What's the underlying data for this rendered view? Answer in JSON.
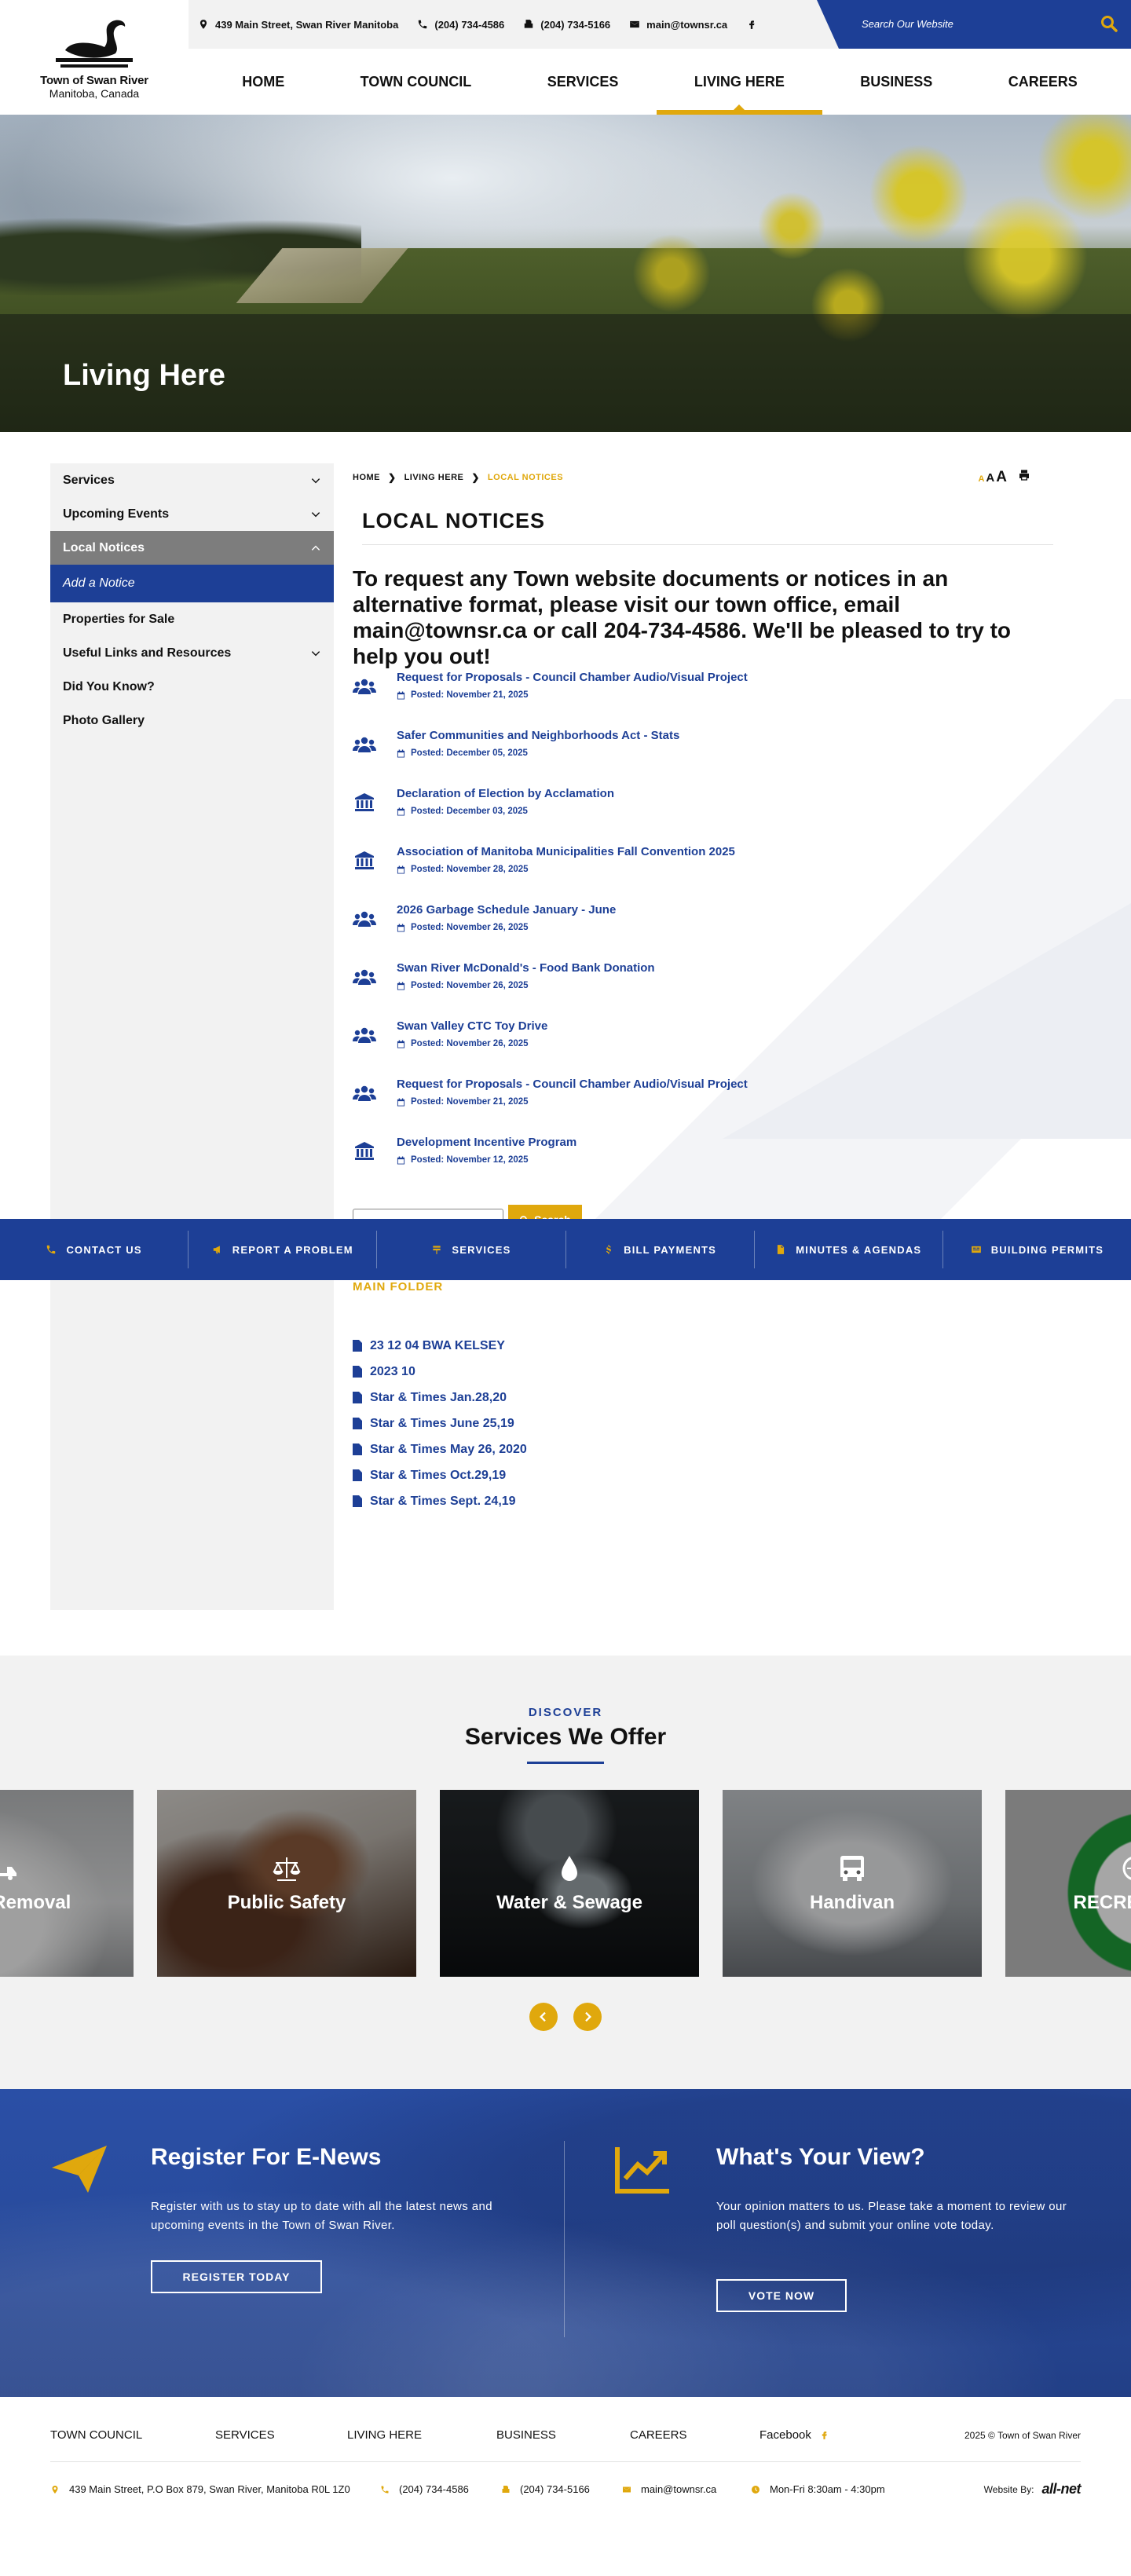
{
  "brand": {
    "name": "Town of Swan River",
    "sub": "Manitoba, Canada"
  },
  "topbar": {
    "address": "439 Main Street, Swan River Manitoba",
    "phone": "(204) 734-4586",
    "fax": "(204) 734-5166",
    "email": "main@townsr.ca",
    "search_placeholder": "Search Our Website"
  },
  "nav": [
    {
      "label": "HOME"
    },
    {
      "label": "TOWN COUNCIL"
    },
    {
      "label": "SERVICES"
    },
    {
      "label": "LIVING HERE",
      "active": true
    },
    {
      "label": "BUSINESS"
    },
    {
      "label": "CAREERS"
    }
  ],
  "hero": {
    "title": "Living Here"
  },
  "sidebar": {
    "items": [
      {
        "label": "Services",
        "chevron": "down"
      },
      {
        "label": "Upcoming Events",
        "chevron": "down"
      },
      {
        "label": "Local Notices",
        "chevron": "up",
        "state": "active"
      },
      {
        "label": "Add a Notice",
        "state": "sub"
      },
      {
        "label": "Properties for Sale"
      },
      {
        "label": "Useful Links and Resources",
        "chevron": "down"
      },
      {
        "label": "Did You Know?"
      },
      {
        "label": "Photo Gallery"
      }
    ]
  },
  "breadcrumb": {
    "home": "HOME",
    "section": "LIVING HERE",
    "current": "LOCAL NOTICES"
  },
  "text_tools": {
    "small": "A",
    "medium": "A",
    "large": "A"
  },
  "page": {
    "title": "LOCAL NOTICES",
    "intro": "To request any Town website documents or notices in an alternative format, please visit our town office, email main@townsr.ca or call 204-734-4586. We'll be pleased to try to help you out!"
  },
  "notices": [
    {
      "title": "Request for Proposals - Council Chamber Audio/Visual Project",
      "date": "Posted: November 21, 2025",
      "icon": "people-icon"
    },
    {
      "title": "Safer Communities and Neighborhoods Act - Stats",
      "date": "Posted: December 05, 2025",
      "icon": "people-icon"
    },
    {
      "title": "Declaration of Election by Acclamation",
      "date": "Posted: December 03, 2025",
      "icon": "building-icon"
    },
    {
      "title": "Association of Manitoba Municipalities Fall Convention 2025",
      "date": "Posted: November 28, 2025",
      "icon": "building-icon"
    },
    {
      "title": "2026 Garbage Schedule January - June",
      "date": "Posted: November 26, 2025",
      "icon": "people-icon"
    },
    {
      "title": "Swan River McDonald's - Food Bank Donation",
      "date": "Posted: November 26, 2025",
      "icon": "people-icon"
    },
    {
      "title": "Swan Valley CTC Toy Drive",
      "date": "Posted: November 26, 2025",
      "icon": "people-icon"
    },
    {
      "title": "Request for Proposals - Council Chamber Audio/Visual Project",
      "date": "Posted: November 21, 2025",
      "icon": "people-icon"
    },
    {
      "title": "Development Incentive Program",
      "date": "Posted: November 12, 2025",
      "icon": "building-icon"
    }
  ],
  "notice_search": {
    "value": "",
    "button": "Search"
  },
  "folder": {
    "title": "MAIN FOLDER",
    "files": [
      "23 12 04 BWA KELSEY",
      "2023 10",
      "Star & Times Jan.28,20",
      "Star & Times June 25,19",
      "Star & Times May 26, 2020",
      "Star & Times Oct.29,19",
      "Star & Times Sept. 24,19"
    ]
  },
  "quickbar": [
    {
      "label": "CONTACT US",
      "icon": "phone-icon"
    },
    {
      "label": "REPORT A PROBLEM",
      "icon": "megaphone-icon"
    },
    {
      "label": "SERVICES",
      "icon": "sign-icon"
    },
    {
      "label": "BILL PAYMENTS",
      "icon": "dollar-icon"
    },
    {
      "label": "MINUTES & AGENDAS",
      "icon": "document-icon"
    },
    {
      "label": "BUILDING PERMITS",
      "icon": "permit-icon"
    }
  ],
  "services": {
    "kicker": "DISCOVER",
    "title": "Services We Offer",
    "cards": [
      {
        "label": "Snow Removal",
        "icon": "snowplow-icon"
      },
      {
        "label": "Public Safety",
        "icon": "scales-icon"
      },
      {
        "label": "Water & Sewage",
        "icon": "water-drop-icon"
      },
      {
        "label": "Handivan",
        "icon": "bus-icon"
      },
      {
        "label": "RECREATION",
        "icon": "recreation-icon"
      }
    ]
  },
  "cta": {
    "enews": {
      "title": "Register For E-News",
      "text": "Register with us to stay up to date with all the latest news and upcoming events in the Town of Swan River.",
      "button": "REGISTER TODAY"
    },
    "poll": {
      "title": "What's Your View?",
      "text": "Your opinion matters to us. Please take a moment to review our poll question(s) and submit your online vote today.",
      "button": "VOTE NOW"
    }
  },
  "footer": {
    "links": [
      "TOWN COUNCIL",
      "SERVICES",
      "LIVING HERE",
      "BUSINESS",
      "CAREERS"
    ],
    "facebook": "Facebook",
    "copyright": "2025 © Town of Swan River",
    "address": "439 Main Street, P.O Box 879, Swan River, Manitoba R0L 1Z0",
    "phone": "(204) 734-4586",
    "fax": "(204) 734-5166",
    "email": "main@townsr.ca",
    "hours": "Mon-Fri 8:30am - 4:30pm",
    "website_by": "Website By:",
    "vendor": "all-net"
  },
  "colors": {
    "brand_blue": "#1d3f96",
    "accent_gold": "#e0a80d",
    "sidebar_bg": "#f2f2f2"
  }
}
